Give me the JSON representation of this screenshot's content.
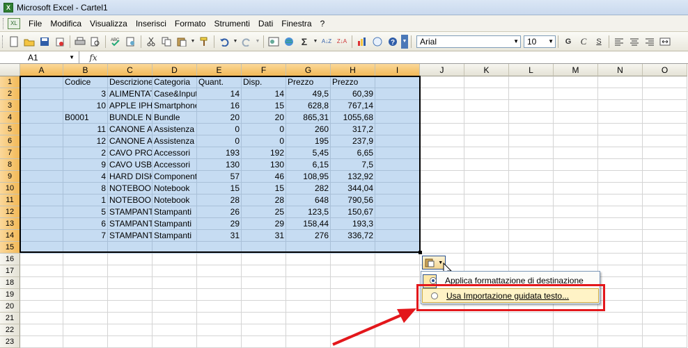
{
  "window": {
    "title": "Microsoft Excel - Cartel1",
    "app_icon": "excel-icon"
  },
  "menu": [
    "File",
    "Modifica",
    "Visualizza",
    "Inserisci",
    "Formato",
    "Strumenti",
    "Dati",
    "Finestra",
    "?"
  ],
  "formatting": {
    "font": "Arial",
    "size": "10",
    "bold": "G",
    "italic": "C",
    "underline": "S"
  },
  "formula_bar": {
    "cell_ref": "A1",
    "fx": "fx",
    "content": ""
  },
  "columns": [
    "A",
    "B",
    "C",
    "D",
    "E",
    "F",
    "G",
    "H",
    "I",
    "J",
    "K",
    "L",
    "M",
    "N",
    "O"
  ],
  "rows": [
    "1",
    "2",
    "3",
    "4",
    "5",
    "6",
    "7",
    "8",
    "9",
    "10",
    "11",
    "12",
    "13",
    "14",
    "15",
    "16",
    "17",
    "18",
    "19",
    "20",
    "21",
    "22",
    "23"
  ],
  "table": [
    [
      "",
      "Codice",
      "Descrizione",
      "Categoria",
      "Quant.",
      "Disp.",
      "Prezzo",
      "Prezzo",
      ""
    ],
    [
      "",
      "3",
      "ALIMENTATORE",
      "Case&Input",
      "14",
      "14",
      "49,5",
      "60,39",
      ""
    ],
    [
      "",
      "10",
      "APPLE IPHONE",
      "Smartphone",
      "16",
      "15",
      "628,8",
      "767,14",
      ""
    ],
    [
      "",
      "B0001",
      "BUNDLE NOTEBOOK",
      "Bundle",
      "20",
      "20",
      "865,31",
      "1055,68",
      ""
    ],
    [
      "",
      "11",
      "CANONE ANNUALE",
      "Assistenza",
      "0",
      "0",
      "260",
      "317,2",
      ""
    ],
    [
      "",
      "12",
      "CANONE ANNUALE",
      "Assistenza",
      "0",
      "0",
      "195",
      "237,9",
      ""
    ],
    [
      "",
      "2",
      "CAVO PROLUNGA",
      "Accessori",
      "193",
      "192",
      "5,45",
      "6,65",
      ""
    ],
    [
      "",
      "9",
      "CAVO USB",
      "Accessori",
      "130",
      "130",
      "6,15",
      "7,5",
      ""
    ],
    [
      "",
      "4",
      "HARD DISK",
      "Componenti",
      "57",
      "46",
      "108,95",
      "132,92",
      ""
    ],
    [
      "",
      "8",
      "NOTEBOOK",
      "Notebook",
      "15",
      "15",
      "282",
      "344,04",
      ""
    ],
    [
      "",
      "1",
      "NOTEBOOK",
      "Notebook",
      "28",
      "28",
      "648",
      "790,56",
      ""
    ],
    [
      "",
      "5",
      "STAMPANTE",
      "Stampanti",
      "26",
      "25",
      "123,5",
      "150,67",
      ""
    ],
    [
      "",
      "6",
      "STAMPANTE",
      "Stampanti",
      "29",
      "29",
      "158,44",
      "193,3",
      ""
    ],
    [
      "",
      "7",
      "STAMPANTE",
      "Stampanti",
      "31",
      "31",
      "276",
      "336,72",
      ""
    ],
    [
      "",
      "",
      "",
      "",
      "",
      "",
      "",
      "",
      ""
    ]
  ],
  "paste_options": {
    "button_icon": "paste-options-icon",
    "option1": "Applica formattazione di destinazione",
    "option2": "Usa Importazione guidata testo..."
  },
  "annotation": {
    "highlight_color": "#e3171b"
  }
}
